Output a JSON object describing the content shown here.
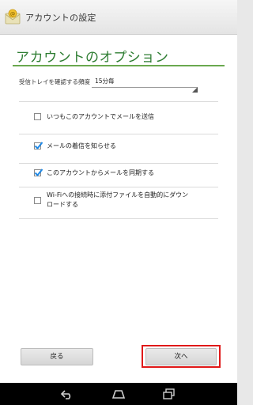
{
  "window": {
    "title": "アカウントの設定",
    "app_icon": "mail-envelope-icon"
  },
  "page": {
    "title": "アカウントのオプション"
  },
  "settings": {
    "check_frequency_label": "受信トレイを確認する頻度",
    "check_frequency_value": "15分毎",
    "options": [
      {
        "label": "いつもこのアカウントでメールを送信",
        "checked": false
      },
      {
        "label": "メールの着信を知らせる",
        "checked": true
      },
      {
        "label": "このアカウントからメールを同期する",
        "checked": true
      },
      {
        "label_line1": "Wi-Fiへの接続時に添付ファイルを自動的にダウン",
        "label_line2": "ロードする",
        "checked": false
      }
    ]
  },
  "buttons": {
    "back_label": "戻る",
    "next_label": "次へ"
  },
  "navigation": {
    "back_icon": "back-icon",
    "home_icon": "home-icon",
    "recents_icon": "recent-apps-icon"
  },
  "colors": {
    "accent": "#2e7d32",
    "accent_rule": "#6aa84f",
    "checkbox_check": "#1e88e5",
    "highlight": "#e01919"
  }
}
